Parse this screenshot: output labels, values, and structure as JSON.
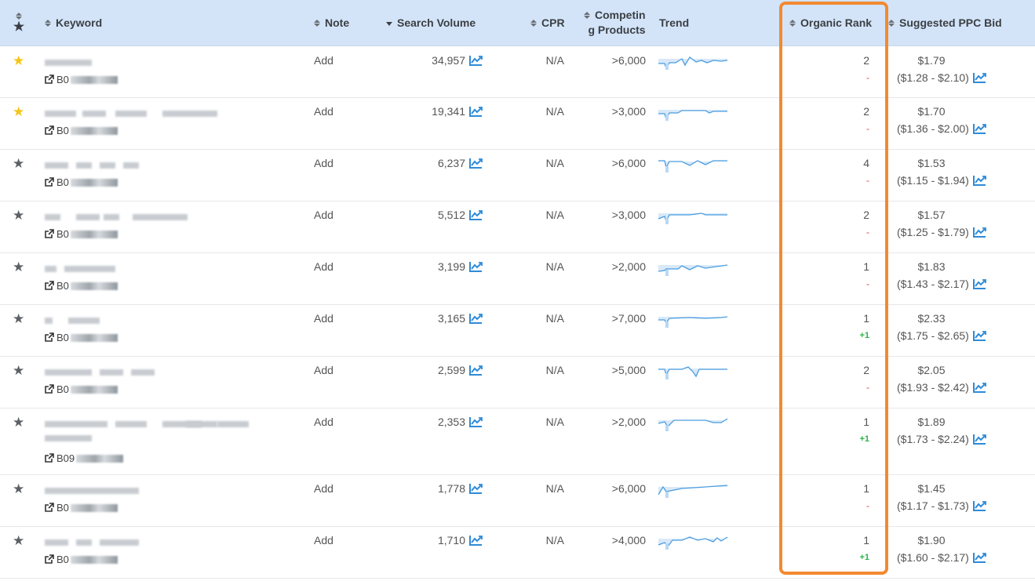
{
  "header": {
    "keyword": "Keyword",
    "note": "Note",
    "search_volume": "Search Volume",
    "cpr": "CPR",
    "competing_line1": "Competin",
    "competing_line2": "g Products",
    "trend": "Trend",
    "organic_rank": "Organic Rank",
    "ppc_bid": "Suggested PPC Bid"
  },
  "colors": {
    "header_bg": "#d3e4f9",
    "accent": "#2e8bd8",
    "highlight": "#f28a30",
    "fav_star": "#f5c518"
  },
  "rows": [
    {
      "fav": true,
      "asin": "B0",
      "note": "Add",
      "volume": "34,957",
      "cpr": "N/A",
      "competing": ">6,000",
      "rank": "2",
      "change": "-",
      "bid": "$1.79",
      "range": "($1.28 - $2.10)"
    },
    {
      "fav": true,
      "asin": "B0",
      "note": "Add",
      "volume": "19,341",
      "cpr": "N/A",
      "competing": ">3,000",
      "rank": "2",
      "change": "-",
      "bid": "$1.70",
      "range": "($1.36 - $2.00)"
    },
    {
      "fav": false,
      "asin": "B0",
      "note": "Add",
      "volume": "6,237",
      "cpr": "N/A",
      "competing": ">6,000",
      "rank": "4",
      "change": "-",
      "bid": "$1.53",
      "range": "($1.15 - $1.94)"
    },
    {
      "fav": false,
      "asin": "B0",
      "note": "Add",
      "volume": "5,512",
      "cpr": "N/A",
      "competing": ">3,000",
      "rank": "2",
      "change": "-",
      "bid": "$1.57",
      "range": "($1.25 - $1.79)"
    },
    {
      "fav": false,
      "asin": "B0",
      "note": "Add",
      "volume": "3,199",
      "cpr": "N/A",
      "competing": ">2,000",
      "rank": "1",
      "change": "-",
      "bid": "$1.83",
      "range": "($1.43 - $2.17)"
    },
    {
      "fav": false,
      "asin": "B0",
      "note": "Add",
      "volume": "3,165",
      "cpr": "N/A",
      "competing": ">7,000",
      "rank": "1",
      "change": "+1",
      "bid": "$2.33",
      "range": "($1.75 - $2.65)"
    },
    {
      "fav": false,
      "asin": "B0",
      "note": "Add",
      "volume": "2,599",
      "cpr": "N/A",
      "competing": ">5,000",
      "rank": "2",
      "change": "-",
      "bid": "$2.05",
      "range": "($1.93 - $2.42)"
    },
    {
      "fav": false,
      "asin": "B09",
      "note": "Add",
      "volume": "2,353",
      "cpr": "N/A",
      "competing": ">2,000",
      "rank": "1",
      "change": "+1",
      "bid": "$1.89",
      "range": "($1.73 - $2.24)"
    },
    {
      "fav": false,
      "asin": "B0",
      "note": "Add",
      "volume": "1,778",
      "cpr": "N/A",
      "competing": ">6,000",
      "rank": "1",
      "change": "-",
      "bid": "$1.45",
      "range": "($1.17 - $1.73)"
    },
    {
      "fav": false,
      "asin": "B0",
      "note": "Add",
      "volume": "1,710",
      "cpr": "N/A",
      "competing": ">4,000",
      "rank": "1",
      "change": "+1",
      "bid": "$1.90",
      "range": "($1.60 - $2.17)"
    }
  ]
}
